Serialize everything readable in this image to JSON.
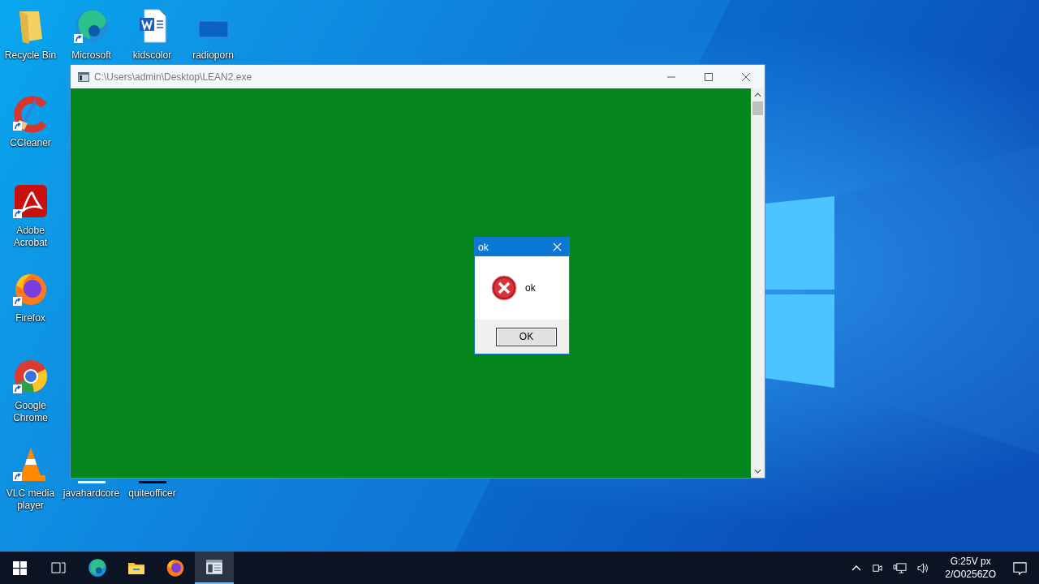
{
  "desktop_icons": [
    {
      "label": "Recycle Bin",
      "kind": "bin",
      "shortcut": false
    },
    {
      "label": "Microsoft",
      "kind": "edge",
      "shortcut": true
    },
    {
      "label": "kidscolor",
      "kind": "word",
      "shortcut": false
    },
    {
      "label": "radioporn",
      "kind": "blank",
      "shortcut": false
    },
    {
      "label": "CCleaner",
      "kind": "ccleaner",
      "shortcut": true
    },
    {
      "label": "Adobe Acrobat",
      "kind": "acrobat",
      "shortcut": true
    },
    {
      "label": "Firefox",
      "kind": "firefox",
      "shortcut": true
    },
    {
      "label": "Google Chrome",
      "kind": "chrome",
      "shortcut": true
    },
    {
      "label": "VLC media player",
      "kind": "vlc",
      "shortcut": true
    },
    {
      "label": "javahardcore",
      "kind": "word"
    },
    {
      "label": "quiteofficer",
      "kind": "blank"
    }
  ],
  "window": {
    "title": "C:\\Users\\admin\\Desktop\\LEAN2.exe"
  },
  "dialog": {
    "title": "ok",
    "message": "ok",
    "button": "OK"
  },
  "taskbar": {
    "items": [
      {
        "kind": "taskview",
        "selected": false
      },
      {
        "kind": "edge",
        "selected": false
      },
      {
        "kind": "explorer",
        "selected": false
      },
      {
        "kind": "firefox",
        "selected": false
      },
      {
        "kind": "console",
        "selected": true
      }
    ],
    "clock": {
      "time": "G:25V px",
      "date": "2/O0256ZO"
    }
  }
}
